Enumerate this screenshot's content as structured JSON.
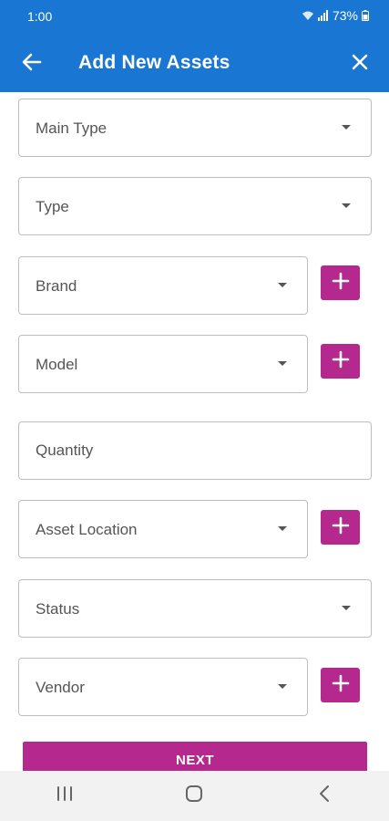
{
  "status_bar": {
    "time": "1:00",
    "battery": "73%"
  },
  "header": {
    "title": "Add New Assets",
    "back_icon": "arrow-left-icon",
    "close_icon": "close-icon"
  },
  "colors": {
    "primary": "#1976d2",
    "accent": "#b5288d"
  },
  "fields": {
    "main_type": {
      "label": "Main Type"
    },
    "type": {
      "label": "Type"
    },
    "brand": {
      "label": "Brand"
    },
    "model": {
      "label": "Model"
    },
    "quantity": {
      "placeholder": "Quantity",
      "value": ""
    },
    "asset_location": {
      "label": "Asset Location"
    },
    "status": {
      "label": "Status"
    },
    "vendor": {
      "label": "Vendor"
    }
  },
  "next_button": {
    "label": "NEXT"
  },
  "nav": {
    "recents_icon": "recents-icon",
    "home_icon": "home-icon",
    "back_icon": "back-chevron-icon"
  }
}
